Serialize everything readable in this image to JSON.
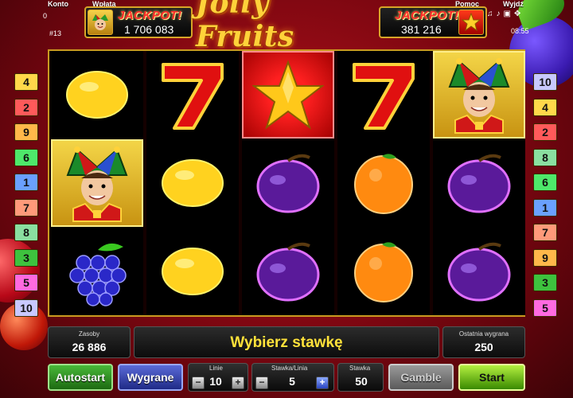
{
  "header": {
    "konto_label": "Konto",
    "konto_value": "0",
    "wplata_label": "Wpłata",
    "pomoc_label": "Pomoc",
    "wyjdz_label": "Wyjdź",
    "game_number": "#13",
    "clock": "08:55",
    "jackpot_word": "JACKPOT!",
    "jackpot_left_value": "1 706 083",
    "jackpot_right_value": "381 216",
    "logo_text": "Jolly Fruits"
  },
  "reels": [
    [
      "lemon",
      "joker",
      "grapes"
    ],
    [
      "seven",
      "lemon",
      "lemon"
    ],
    [
      "star",
      "plum",
      "plum"
    ],
    [
      "seven",
      "orange",
      "orange"
    ],
    [
      "joker",
      "plum",
      "plum"
    ]
  ],
  "lines_left": [
    "4",
    "2",
    "9",
    "6",
    "1",
    "7",
    "8",
    "3",
    "5",
    "10"
  ],
  "lines_right": [
    "10",
    "4",
    "2",
    "8",
    "6",
    "1",
    "7",
    "9",
    "3",
    "5"
  ],
  "line_colors": {
    "1": "#6aa0ff",
    "2": "#ff5a5a",
    "3": "#3ec23e",
    "4": "#ffd84a",
    "5": "#ff6ae0",
    "6": "#4ee86a",
    "7": "#ff9a7a",
    "8": "#8adfa0",
    "9": "#ffb84a",
    "10": "#c8c8ff"
  },
  "bottom": {
    "zasoby_label": "Zasoby",
    "zasoby_value": "26 886",
    "message": "Wybierz stawkę",
    "ostatnia_label": "Ostatnia wygrana",
    "ostatnia_value": "250",
    "autostart_label": "Autostart",
    "wygrane_label": "Wygrane",
    "linie_label": "Linie",
    "linie_value": "10",
    "stawka_linia_label": "Stawka/Linia",
    "stawka_linia_value": "5",
    "stawka_label": "Stawka",
    "stawka_value": "50",
    "gamble_label": "Gamble",
    "start_label": "Start",
    "minus": "−",
    "plus": "+"
  }
}
